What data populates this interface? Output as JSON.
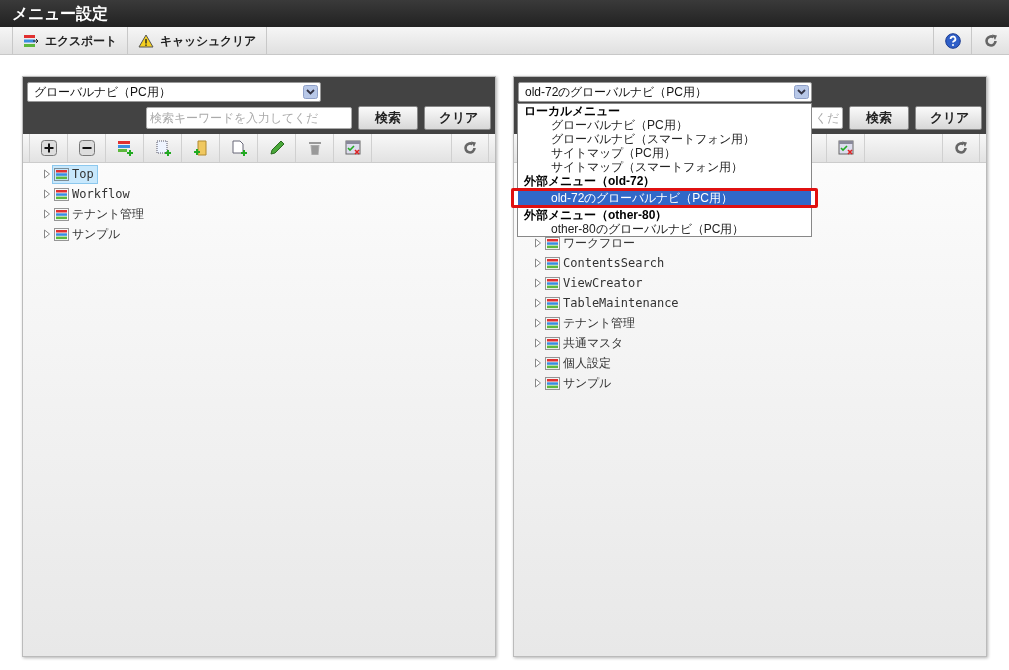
{
  "title": "メニュー設定",
  "toolbar": {
    "buttons": [
      {
        "kind": "export",
        "label": "エクスポート"
      },
      {
        "kind": "warning",
        "label": "キャッシュクリア"
      }
    ],
    "icons": [
      {
        "kind": "help"
      },
      {
        "kind": "refresh"
      }
    ]
  },
  "panels": [
    {
      "select_value": "グローバルナビ（PC用）",
      "search": {
        "placeholder": "検索キーワードを入力してくだ"
      },
      "buttons": [
        "検索",
        "クリア"
      ],
      "tools": [
        {
          "kind": "plus"
        },
        {
          "kind": "minus"
        },
        {
          "kind": "add-list"
        },
        {
          "kind": "add-doc"
        },
        {
          "kind": "add-folder"
        },
        {
          "kind": "add-page"
        },
        {
          "kind": "pencil"
        },
        {
          "kind": "trash"
        },
        {
          "kind": "window"
        }
      ],
      "tree": [
        {
          "label": "Top",
          "selected": true
        },
        {
          "label": "Workflow",
          "selected": false
        },
        {
          "label": "テナント管理",
          "selected": false
        },
        {
          "label": "サンプル",
          "selected": false
        }
      ]
    },
    {
      "select_value": "old-72のグローバルナビ（PC用）",
      "search": {
        "placeholder": "くだ"
      },
      "buttons": [
        "検索",
        "クリア"
      ],
      "tools": [
        {
          "kind": "window"
        }
      ],
      "dropdown": [
        {
          "kind": "group",
          "label": "ローカルメニュー"
        },
        {
          "kind": "option",
          "label": "グローバルナビ（PC用）",
          "selected": false,
          "highlighted": false
        },
        {
          "kind": "option",
          "label": "グローバルナビ（スマートフォン用）",
          "selected": false,
          "highlighted": false
        },
        {
          "kind": "option",
          "label": "サイトマップ（PC用）",
          "selected": false,
          "highlighted": false
        },
        {
          "kind": "option",
          "label": "サイトマップ（スマートフォン用）",
          "selected": false,
          "highlighted": false
        },
        {
          "kind": "group",
          "label": "外部メニュー（old-72）"
        },
        {
          "kind": "option",
          "label": "old-72のグローバルナビ（PC用）",
          "selected": true,
          "highlighted": true
        },
        {
          "kind": "group",
          "label": "外部メニュー（other-80）"
        },
        {
          "kind": "option",
          "label": "other-80のグローバルナビ（PC用）",
          "selected": false,
          "highlighted": false
        }
      ],
      "tree": [
        {
          "label": "ワークフロー",
          "selected": false
        },
        {
          "label": "ContentsSearch",
          "selected": false
        },
        {
          "label": "ViewCreator",
          "selected": false
        },
        {
          "label": "TableMaintenance",
          "selected": false
        },
        {
          "label": "テナント管理",
          "selected": false
        },
        {
          "label": "共通マスタ",
          "selected": false
        },
        {
          "label": "個人設定",
          "selected": false
        },
        {
          "label": "サンプル",
          "selected": false
        }
      ]
    }
  ]
}
